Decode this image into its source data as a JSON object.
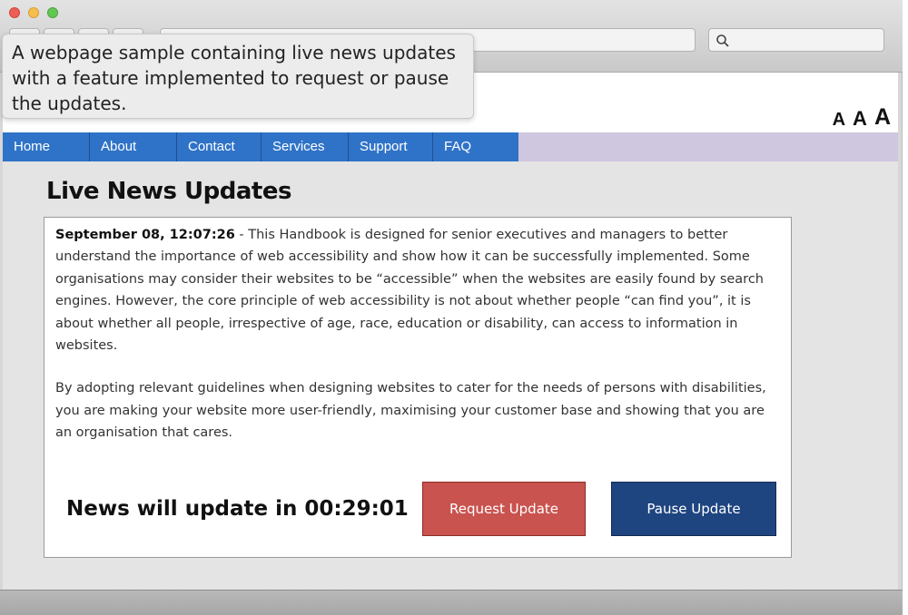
{
  "tooltip": {
    "text": "A webpage sample containing live news updates with a feature implemented to request or pause the updates."
  },
  "browser": {
    "search_icon": "search-icon"
  },
  "font_controls": [
    "A",
    "A",
    "A"
  ],
  "nav": {
    "items": [
      "Home",
      "About",
      "Contact",
      "Services",
      "Support",
      "FAQ"
    ]
  },
  "main": {
    "heading": "Live News Updates",
    "news": {
      "date": "September 08, 12:07:26",
      "paragraph1": " - This Handbook is designed for senior executives and managers to better understand the importance of web accessibility and show how it can be successfully implemented. Some organisations may consider their websites to be “accessible” when the websites are easily found by search engines. However, the core principle of web accessibility is not about whether people “can find you”, it is about whether all people, irrespective of age, race, education or disability, can access to information in websites.",
      "paragraph2": "By adopting relevant guidelines when designing websites to cater for the needs of persons with disabilities, you are making your website more user-friendly, maximising your customer base and showing that you are an organisation that cares."
    },
    "countdown": "News will update in 00:29:01",
    "request_button": "Request Update",
    "pause_button": "Pause Update"
  },
  "colors": {
    "nav_blue": "#2f73c8",
    "request_red": "#c9534f",
    "pause_navy": "#1f4580",
    "nav_bar_lavender": "#cfc6df"
  }
}
